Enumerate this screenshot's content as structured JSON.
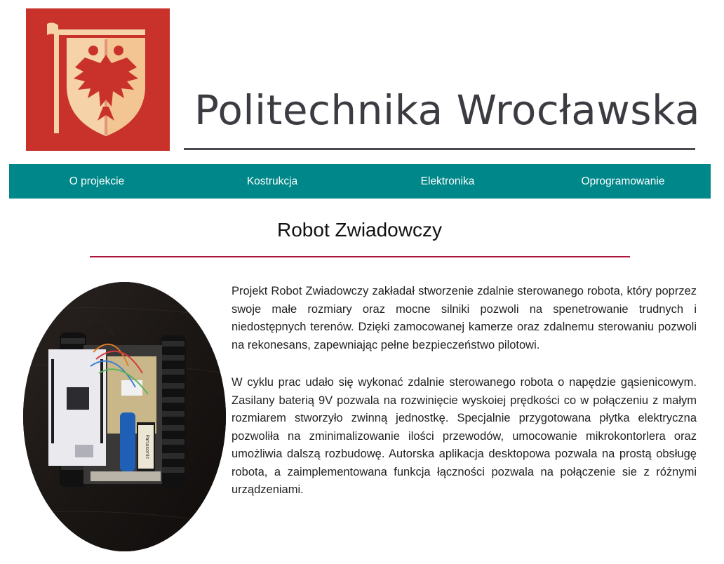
{
  "brand": {
    "name": "Politechnika Wrocławska",
    "logo_icon": "eagle-crest-icon",
    "logo_color": "#c8322a",
    "logo_accent": "#f6d2a8"
  },
  "nav": {
    "items": [
      {
        "label": "O projekcie"
      },
      {
        "label": "Kostrukcja"
      },
      {
        "label": "Elektronika"
      },
      {
        "label": "Oprogramowanie"
      }
    ],
    "color": "#00878a"
  },
  "main": {
    "title": "Robot Zwiadowczy",
    "accent_color": "#b0163d",
    "paragraphs": [
      "Projekt Robot Zwiadowczy zakładał stworzenie zdalnie sterowanego robota, który poprzez swoje małe rozmiary oraz mocne silniki pozwoli na spenetrowanie trudnych i niedostępnych terenów. Dzięki zamocowanej kamerze oraz zdalnemu sterowaniu pozwoli na rekonesans, zapewniając pełne bezpieczeństwo pilotowi.",
      "W cyklu prac udało się wykonać zdalnie sterowanego robota o napędzie gąsienicowym. Zasilany baterią 9V pozwala na rozwinięcie wyskoiej prędkości co w połączeniu z małym rozmiarem stworzyło zwinną jednostkę. Specjalnie przygotowana płytka elektryczna pozwoliła na zminimalizowanie ilości przewodów, umocowanie mikrokontorlera oraz umożliwia dalszą rozbudowę. Autorska aplikacja desktopowa pozwala na prostą obsługę robota, a zaimplementowana funkcja łączności pozwala na połączenie sie z różnymi urządzeniami."
    ],
    "photo": {
      "battery_label": "Panasonic"
    }
  }
}
